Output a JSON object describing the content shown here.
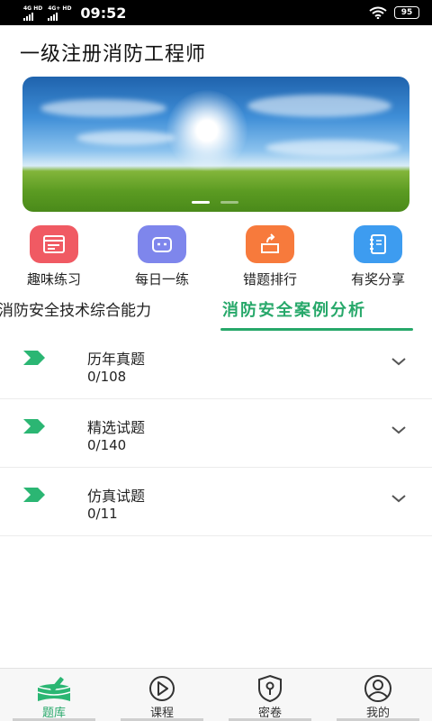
{
  "status_bar": {
    "sim1": "4G HD",
    "sim2": "4G+ HD",
    "time": "09:52",
    "battery": "95"
  },
  "page": {
    "title": "一级注册消防工程师"
  },
  "banner": {
    "slide_count": 2,
    "active_slide": 0
  },
  "quick_actions": [
    {
      "label": "趣味练习",
      "icon": "practice-icon",
      "color": "#f05a63"
    },
    {
      "label": "每日一练",
      "icon": "daily-icon",
      "color": "#7e86ec"
    },
    {
      "label": "错题排行",
      "icon": "wrong-rank-icon",
      "color": "#f77a3c"
    },
    {
      "label": "有奖分享",
      "icon": "share-notebook-icon",
      "color": "#3d9cf0"
    }
  ],
  "tabs": [
    {
      "label": "消防安全技术综合能力",
      "active": false
    },
    {
      "label": "消防安全案例分析",
      "active": true
    }
  ],
  "question_sets": [
    {
      "title": "历年真题",
      "progress": "0/108"
    },
    {
      "title": "精选试题",
      "progress": "0/140"
    },
    {
      "title": "仿真试题",
      "progress": "0/11"
    }
  ],
  "bottom_nav": [
    {
      "label": "题库",
      "icon": "books-icon",
      "active": true
    },
    {
      "label": "课程",
      "icon": "play-icon",
      "active": false
    },
    {
      "label": "密卷",
      "icon": "lock-shield-icon",
      "active": false
    },
    {
      "label": "我的",
      "icon": "user-icon",
      "active": false
    }
  ],
  "colors": {
    "accent": "#27a86a",
    "status_bar_bg": "#000000"
  }
}
